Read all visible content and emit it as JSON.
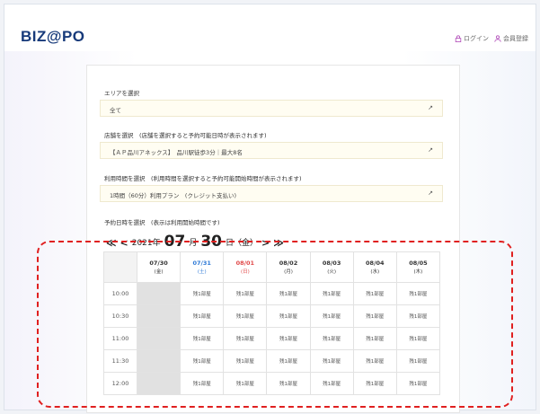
{
  "header": {
    "logo": "BIZ@PO",
    "login_label": "ログイン",
    "register_label": "会員登録"
  },
  "form": {
    "area": {
      "label": "エリアを選択",
      "value": "全て"
    },
    "store": {
      "label": "店舗を選択　(店舗を選択すると予約可能日時が表示されます)",
      "value": "【ＡＰ品川アネックス】　品川駅徒歩3分｜最大8名"
    },
    "time": {
      "label": "利用時間を選択　(利用時間を選択すると予約可能開始時間が表示されます)",
      "value": "1時間（60分）利用プラン　(クレジット支払い)"
    },
    "reservation_label": "予約日時を選択　(表示は利用開始時間です)"
  },
  "date_nav": {
    "prev_fast": "≪",
    "prev": "<",
    "year": "2021年",
    "month": "07",
    "month_unit": "月",
    "day": "30",
    "day_suffix": "日（金）",
    "next": ">",
    "next_fast": "≫"
  },
  "schedule": {
    "days": [
      {
        "date": "07/30",
        "dow": "(金)",
        "type": "weekday"
      },
      {
        "date": "07/31",
        "dow": "(土)",
        "type": "sat"
      },
      {
        "date": "08/01",
        "dow": "(日)",
        "type": "sun"
      },
      {
        "date": "08/02",
        "dow": "(月)",
        "type": "weekday"
      },
      {
        "date": "08/03",
        "dow": "(火)",
        "type": "weekday"
      },
      {
        "date": "08/04",
        "dow": "(水)",
        "type": "weekday"
      },
      {
        "date": "08/05",
        "dow": "(木)",
        "type": "weekday"
      }
    ],
    "times": [
      "10:00",
      "10:30",
      "11:00",
      "11:30",
      "12:00"
    ],
    "slot_label": "残1部屋"
  },
  "colors": {
    "logo": "#173a7a",
    "saturday": "#2f7ad6",
    "sunday": "#e04848",
    "highlight_border": "#e02020",
    "field_bg": "#fffdf2"
  }
}
